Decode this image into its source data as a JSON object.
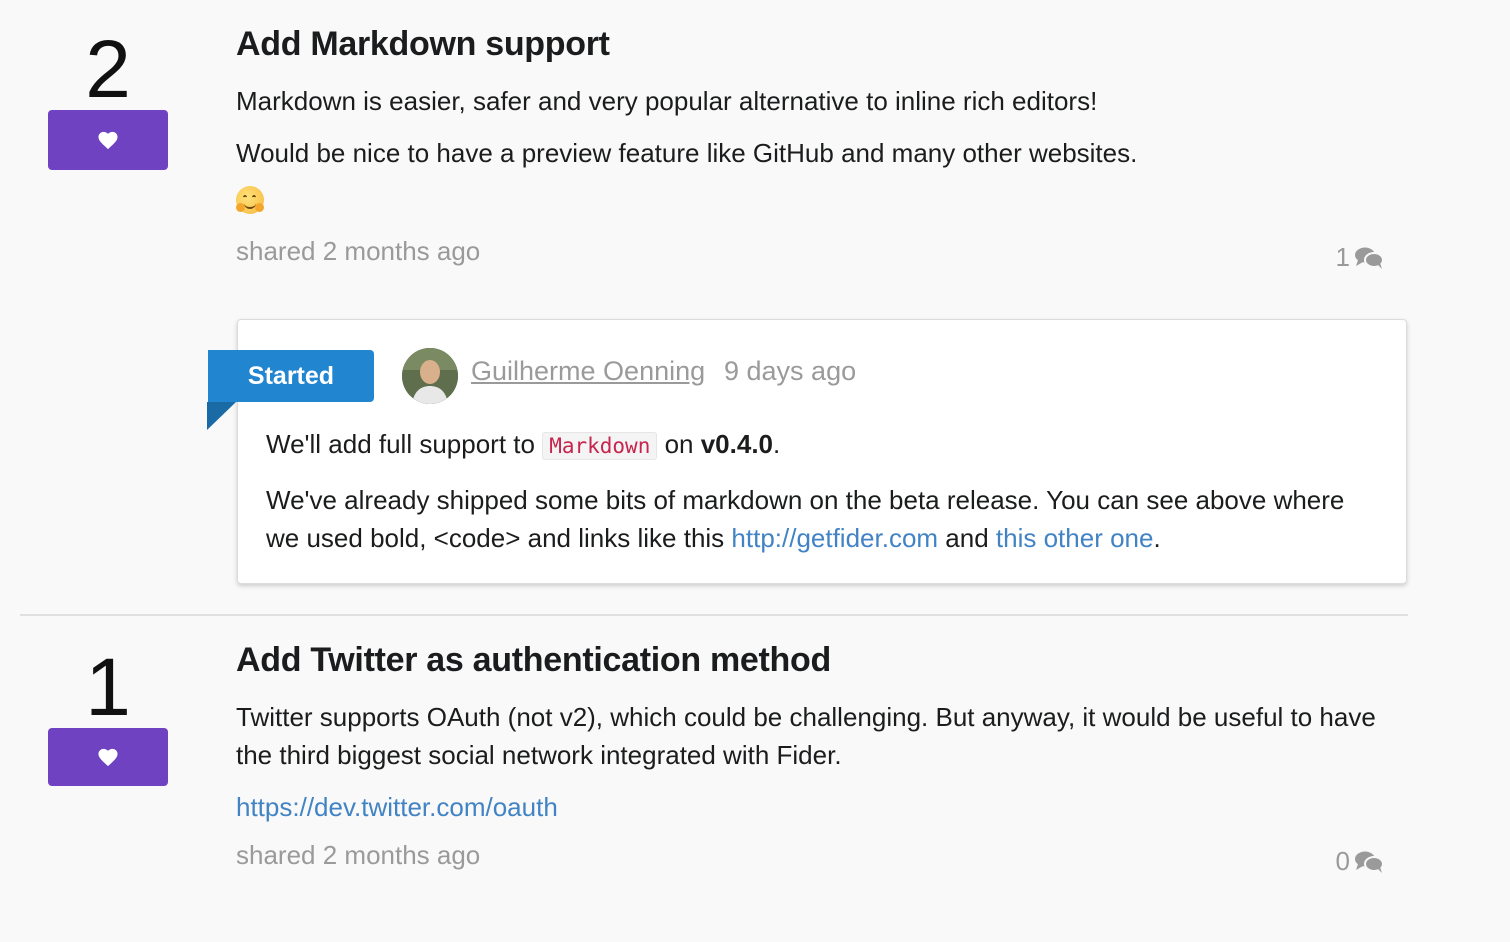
{
  "ideas": [
    {
      "votes": "2",
      "title": "Add Markdown support",
      "description": [
        "Markdown is easier, safer and very popular alternative to inline rich editors!",
        "Would be nice to have a preview feature like GitHub and many other websites."
      ],
      "emoji": "hugging-face",
      "shared": "shared 2 months ago",
      "comment_count": "1",
      "response": {
        "status": "Started",
        "author": "Guilherme Oenning",
        "time": "9 days ago",
        "line1": {
          "before": "We'll add full support to ",
          "code": "Markdown",
          "middle": " on ",
          "bold": "v0.4.0",
          "after": "."
        },
        "line2": {
          "before": "We've already shipped some bits of markdown on the beta release. You can see above where we used bold, <code> and links like this ",
          "link1": "http://getfider.com",
          "middle": " and ",
          "link2": "this other one",
          "after": "."
        }
      }
    },
    {
      "votes": "1",
      "title": "Add Twitter as authentication method",
      "description": [
        "Twitter supports OAuth (not v2), which could be challenging. But anyway, it would be useful to have the third biggest social network integrated with Fider."
      ],
      "link": "https://dev.twitter.com/oauth",
      "shared": "shared 2 months ago",
      "comment_count": "0"
    }
  ],
  "colors": {
    "vote_button": "#6f42c1",
    "status_started": "#2185d0",
    "link": "#4183c4",
    "code": "#c7254e",
    "muted": "#9a9a9a"
  },
  "icons": {
    "vote": "heart-icon",
    "comments": "comments-icon"
  }
}
